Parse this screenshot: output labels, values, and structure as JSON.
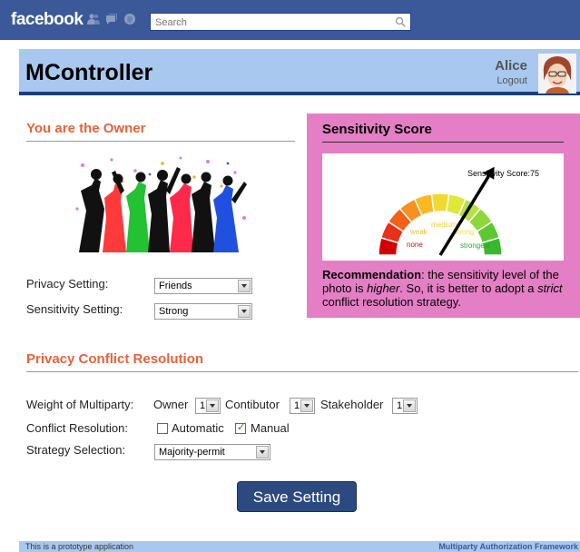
{
  "facebook": {
    "logo": "facebook",
    "search_placeholder": "Search",
    "icons": [
      "friends-icon",
      "messages-icon",
      "notifications-icon",
      "search-icon"
    ]
  },
  "app": {
    "title": "MController",
    "user_name": "Alice",
    "logout_label": "Logout"
  },
  "owner_section": {
    "title": "You are the Owner",
    "privacy_label": "Privacy Setting:",
    "privacy_value": "Friends",
    "sensitivity_label": "Sensitivity Setting:",
    "sensitivity_value": "Strong"
  },
  "sensitivity_panel": {
    "title": "Sensitivity Score",
    "gauge_label": "Sensitivity Score:75",
    "score": 75,
    "gauge_levels": [
      "none",
      "weak",
      "medium",
      "strong",
      "strongest"
    ],
    "recommendation_label": "Recommendation",
    "recommendation_pre": ": the sensitivity level of the photo is ",
    "recommendation_em1": "higher",
    "recommendation_mid": ". So, it is better to adopt a ",
    "recommendation_em2": "strict",
    "recommendation_post": " conflict resolution strategy."
  },
  "conflict_section": {
    "title": "Privacy Conflict Resolution",
    "weight_label": "Weight of Multiparty:",
    "owner_label": "Owner",
    "owner_value": "1",
    "contributor_label": "Contibutor",
    "contributor_value": "1",
    "stakeholder_label": "Stakeholder",
    "stakeholder_value": "1",
    "resolution_label": "Conflict Resolution:",
    "automatic_label": "Automatic",
    "automatic_checked": false,
    "manual_label": "Manual",
    "manual_checked": true,
    "strategy_label": "Strategy Selection:",
    "strategy_value": "Majority-permit"
  },
  "save_label": "Save Setting",
  "footer": {
    "left": "This is a prototype application",
    "right": "Multiparty Authorization Framework"
  },
  "colors": {
    "facebook_blue": "#3b5998",
    "header_blue": "#a8c8ef",
    "section_orange": "#e8623a",
    "panel_pink": "#e57fc5",
    "button_navy": "#2c4a80"
  }
}
